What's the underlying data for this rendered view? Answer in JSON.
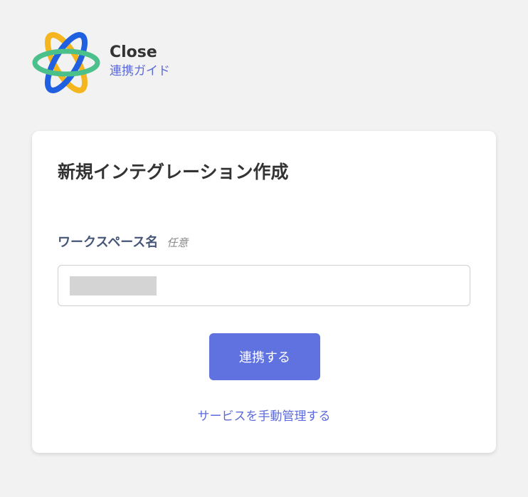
{
  "header": {
    "brand_name": "Close",
    "guide_link": "連携ガイド",
    "logo_icon": "orbit-logo-icon"
  },
  "card": {
    "title": "新規インテグレーション作成",
    "workspace_field": {
      "label": "ワークスペース名",
      "optional_tag": "任意",
      "value": ""
    },
    "submit_label": "連携する",
    "manage_link": "サービスを手動管理する"
  },
  "colors": {
    "background": "#f2f2f2",
    "card": "#ffffff",
    "accent": "#5f72e0",
    "link": "#5c6bd8",
    "label": "#465677",
    "logo_blue": "#1f5fe0",
    "logo_yellow": "#f5b51e",
    "logo_green": "#4cc08a"
  }
}
